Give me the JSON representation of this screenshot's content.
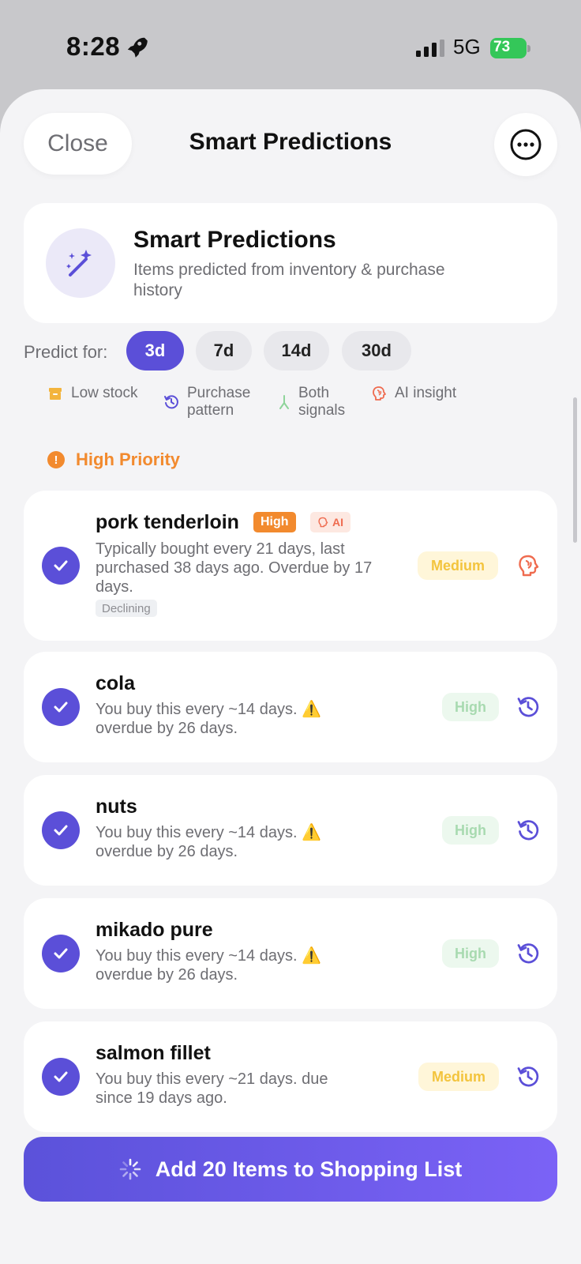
{
  "status_bar": {
    "time": "8:28",
    "network": "5G",
    "battery": "73"
  },
  "nav": {
    "close_label": "Close",
    "title": "Smart Predictions"
  },
  "header": {
    "title": "Smart Predictions",
    "subtitle": "Items predicted from inventory & purchase history"
  },
  "predict": {
    "label": "Predict for:",
    "options": [
      "3d",
      "7d",
      "14d",
      "30d"
    ],
    "selected": "3d"
  },
  "legend": [
    {
      "icon": "low-stock-icon",
      "label": "Low stock"
    },
    {
      "icon": "purchase-pattern-icon",
      "label": "Purchase pattern"
    },
    {
      "icon": "both-signals-icon",
      "label": "Both signals"
    },
    {
      "icon": "ai-insight-icon",
      "label": "AI insight"
    }
  ],
  "section": {
    "title": "High Priority"
  },
  "items": [
    {
      "name": "pork tenderloin",
      "priority_badge": "High",
      "ai_badge": "AI",
      "description": "Typically bought every 21 days, last purchased 38 days ago. Overdue by 17 days.",
      "trend": "Declining",
      "confidence": "Medium",
      "type_icon": "ai-insight-icon",
      "checked": true
    },
    {
      "name": "cola",
      "description_line1": "You buy this every ~14 days. ⚠️",
      "description_line2": "overdue by 26 days.",
      "confidence": "High",
      "type_icon": "purchase-pattern-icon",
      "checked": true
    },
    {
      "name": "nuts",
      "description_line1": "You buy this every ~14 days. ⚠️",
      "description_line2": "overdue by 26 days.",
      "confidence": "High",
      "type_icon": "purchase-pattern-icon",
      "checked": true
    },
    {
      "name": "mikado pure",
      "description_line1": "You buy this every ~14 days. ⚠️",
      "description_line2": "overdue by 26 days.",
      "confidence": "High",
      "type_icon": "purchase-pattern-icon",
      "checked": true
    },
    {
      "name": "salmon fillet",
      "description_line1": "You buy this every ~21 days. due",
      "description_line2": "since 19 days ago.",
      "confidence": "Medium",
      "type_icon": "purchase-pattern-icon",
      "checked": true
    }
  ],
  "add_button": {
    "label": "Add 20 Items to Shopping List"
  },
  "colors": {
    "accent": "#5b4fd8",
    "priority": "#f28a2e",
    "medium": "#f3c43d",
    "high": "#a8dab0",
    "ai": "#ef6b4f"
  }
}
